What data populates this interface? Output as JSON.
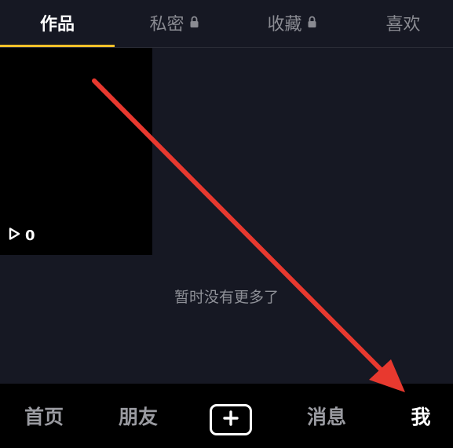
{
  "tabs": [
    {
      "label": "作品",
      "locked": false,
      "active": true
    },
    {
      "label": "私密",
      "locked": true,
      "active": false
    },
    {
      "label": "收藏",
      "locked": true,
      "active": false
    },
    {
      "label": "喜欢",
      "locked": false,
      "active": false
    }
  ],
  "video": {
    "play_count": "0"
  },
  "empty_message": "暂时没有更多了",
  "bottom_nav": {
    "home": "首页",
    "friends": "朋友",
    "messages": "消息",
    "me": "我"
  },
  "icons": {
    "lock": "lock-icon",
    "play": "play-icon",
    "add": "plus-icon"
  },
  "colors": {
    "background": "#161823",
    "tab_indicator": "#f7c12a",
    "annotation_arrow": "#e8392f"
  }
}
